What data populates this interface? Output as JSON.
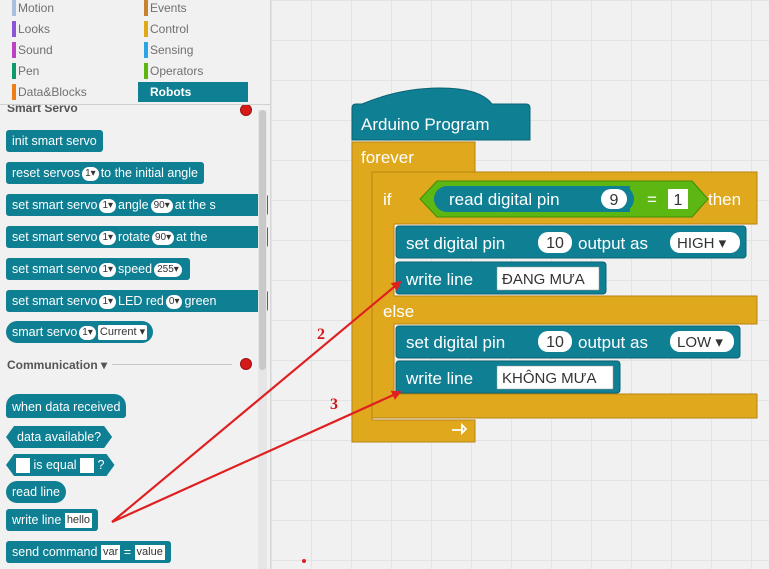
{
  "categories": {
    "left": [
      {
        "label": "Motion",
        "color": "#a8c0e0"
      },
      {
        "label": "Looks",
        "color": "#8a55d7"
      },
      {
        "label": "Sound",
        "color": "#bb42c3"
      },
      {
        "label": "Pen",
        "color": "#0e9a6c"
      },
      {
        "label": "Data&Blocks",
        "color": "#ee7d16"
      }
    ],
    "right": [
      {
        "label": "Events",
        "color": "#c88330"
      },
      {
        "label": "Control",
        "color": "#e1a91a"
      },
      {
        "label": "Sensing",
        "color": "#2ca5e2"
      },
      {
        "label": "Operators",
        "color": "#5cb712"
      },
      {
        "label": "Robots",
        "color": "#0f7f93"
      }
    ]
  },
  "palette": {
    "section_smart_servo": "Smart Servo",
    "smart_servo_blocks": {
      "init": "init smart servo",
      "reset_pre": "reset servos",
      "reset_val": "1▾",
      "reset_post": "to the initial angle",
      "angle_pre": "set smart servo",
      "angle_val": "1▾",
      "angle_mid": "angle",
      "angle_num": "90▾",
      "angle_post": "at the s",
      "rotate_pre": "set smart servo",
      "rotate_val": "1▾",
      "rotate_mid": "rotate",
      "rotate_num": "90▾",
      "rotate_post": "at the",
      "speed_pre": "set smart servo",
      "speed_val": "1▾",
      "speed_mid": "speed",
      "speed_num": "255▾",
      "led_pre": "set smart servo",
      "led_val": "1▾",
      "led_mid": "LED red",
      "led_num": "0▾",
      "led_post": "green",
      "report_pre": "smart servo",
      "report_val": "1▾",
      "report_sel": "Current ▾"
    },
    "section_communication": "Communication ▾",
    "comm_blocks": {
      "when": "when data received",
      "available": "data available?",
      "is_equal": "is equal",
      "q": "?",
      "read_line": "read line",
      "write_line": "write line",
      "write_val": "hello",
      "send_pre": "send command",
      "send_var": "var",
      "send_eq": "=",
      "send_val": "value"
    }
  },
  "script": {
    "hat": "Arduino Program",
    "forever": "forever",
    "if": "if",
    "read_pin": "read  digital  pin",
    "read_pin_val": "9",
    "eq": "=",
    "eq_val": "1",
    "then": "then",
    "set_pin": "set  digital  pin",
    "pin_val": "10",
    "output_as": "output  as",
    "high": "HIGH ▾",
    "low": "LOW ▾",
    "write_line": "write  line",
    "msg1": "ĐANG MƯA",
    "else": "else",
    "msg2": "KHÔNG MƯA"
  },
  "annotations": {
    "label_2": "2",
    "label_3": "3",
    "arrow_color": "#e02020"
  }
}
